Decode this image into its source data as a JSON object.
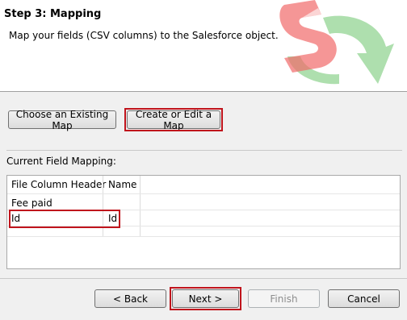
{
  "header": {
    "step_title": "Step 3: Mapping",
    "step_subtitle": "Map your fields (CSV columns) to the Salesforce object."
  },
  "map_buttons": {
    "choose_existing": "Choose an Existing Map",
    "create_or_edit": "Create or Edit a Map"
  },
  "current_mapping": {
    "label": "Current Field Mapping:",
    "columns": [
      "File Column Header",
      "Name"
    ],
    "rows": [
      [
        "Fee paid",
        ""
      ],
      [
        "Id",
        "Id"
      ],
      [
        "",
        ""
      ]
    ]
  },
  "footer": {
    "back": "< Back",
    "next": "Next >",
    "finish": "Finish",
    "cancel": "Cancel"
  },
  "colors": {
    "highlight": "#c0141c",
    "logo_red": "#f26b6b",
    "logo_green": "#4fb54f"
  }
}
